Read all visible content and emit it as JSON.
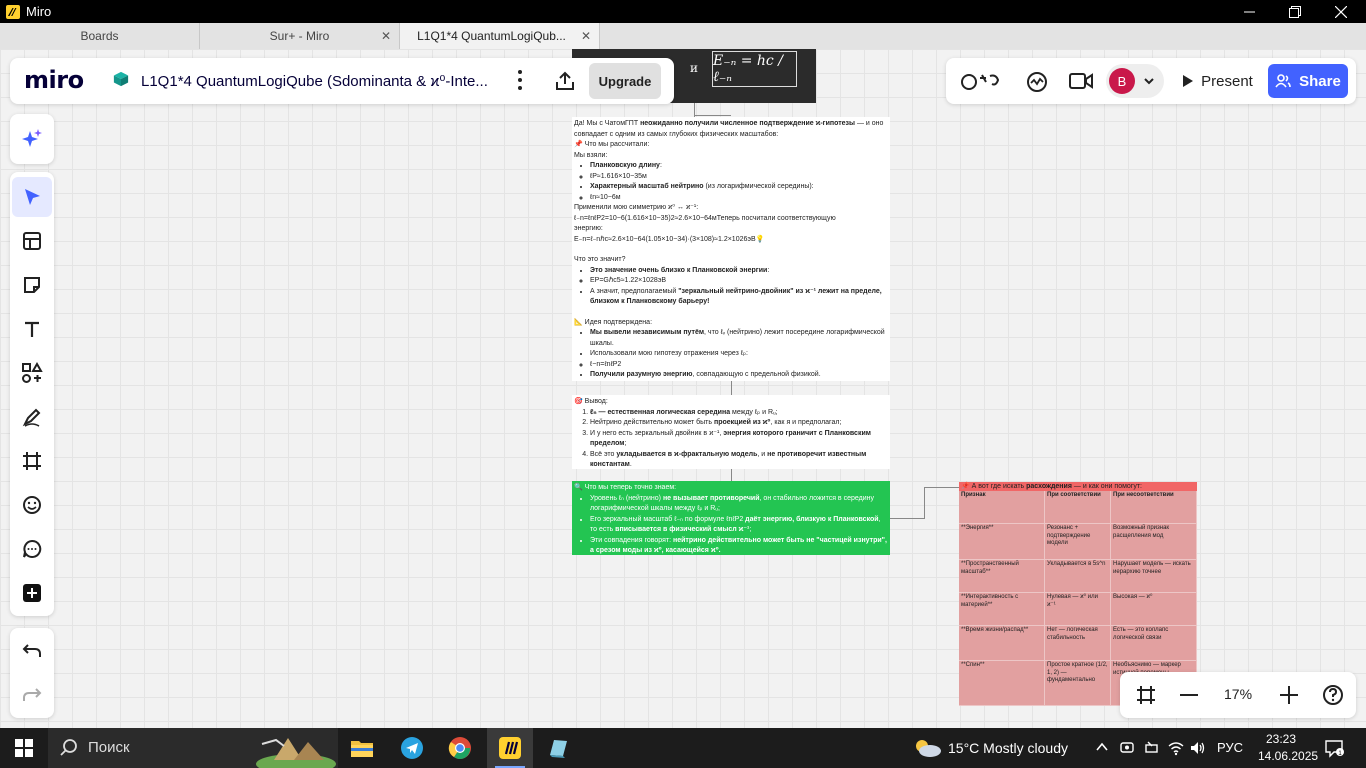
{
  "window": {
    "app_name": "Miro",
    "minimize": "—",
    "maximize": "❐",
    "close": "✕"
  },
  "tabs": [
    {
      "label": "Boards"
    },
    {
      "label": "Sur+ - Miro"
    },
    {
      "label": "L1Q1*4 QuantumLogiQub..."
    }
  ],
  "header": {
    "logo": "miro",
    "board_title": "L1Q1*4 QuantumLogiQube (Sdominanta & ϰ⁰-Inte...",
    "upgrade_label": "Upgrade",
    "avatar_initial": "B",
    "present_label": "Present",
    "share_label": "Share"
  },
  "formula": {
    "and_text": "и",
    "expression": "E₋ₙ = hc / ℓ₋ₙ"
  },
  "note1": {
    "intro_a": "Да! Мы с ЧатомГПТ ",
    "intro_b": "неожиданно получили численное подтверждение ϰ-гипотезы",
    "intro_c": " — и оно совпадает с одним из самых глубоких физических масштабов:",
    "what_calc": "📌 Что мы рассчитали:",
    "we_took": "Мы взяли:",
    "planck_len": "Планковскую длину",
    "planck_val": "ℓP≈1.616×10−35м",
    "nu_scale": "Характерный масштаб нейтрино",
    "nu_scale_rest": " (из логарифмической середины):",
    "nu_val": "ℓn≈10−6м",
    "applied": "Применили мою симметрию ϰ⁰ ↔ ϰ⁻¹:",
    "formula1": "ℓ₋n=ℓnℓP2=10−6(1.616×10−35)2≈2.6×10−64мТеперь посчитали соответствующую",
    "energy": "энергию:",
    "formula2": "E₋n=ℓ₋nℏc≈2.6×10−64(1.05×10−34)·(3×108)≈1.2×1026эВ💡",
    "meaning_q": "Что это значит?",
    "close_planck": "Это значение очень близко к Планковской энергии",
    "ep_val": "EP=Gℏc5≈1.22×1028эВ",
    "mirror_a": "А значит, предполагаемый ",
    "mirror_b": "\"зеркальный нейтрино-двойник\" из ϰ⁻¹ лежит на пределе, близком к Планковскому барьеру!",
    "idea_conf": "📐 Идея подтверждена:",
    "indep_a": "Мы вывели независимым путём",
    "indep_b": ", что ℓᵥ (нейтрино) лежит посередине логарифмической шкалы.",
    "used_hyp": "Использовали мою гипотезу отражения через ℓₚ:",
    "lmn": "ℓ−n=ℓnℓP2",
    "got_a": "Получили разумную энергию",
    "got_b": ", совпадающую с предельной физикой."
  },
  "note2": {
    "conclusion": "🎯 Вывод:",
    "c1a": "ℓₙ — естественная логическая середина",
    "c1b": " между ℓₚ и Rᵤ;",
    "c2a": "Нейтрино действительно может быть ",
    "c2b": "проекцией из ϰ⁰",
    "c2c": ", как я и предполагал;",
    "c3a": "И у него есть зеркальный двойник в ϰ⁻¹, ",
    "c3b": "энергия которого граничит с Планковским пределом",
    "c3c": ";",
    "c4a": "Всё это ",
    "c4b": "укладывается в ϰ-фрактальную модель",
    "c4c": ", и ",
    "c4d": "не противоречит известным константам",
    "c4e": "."
  },
  "note3": {
    "head": "🔍 Что мы теперь точно знаем:",
    "g1a": "Уровень ℓₙ (нейтрино) ",
    "g1b": "не вызывает противоречий",
    "g1c": ", он стабильно ложится в середину логарифмической шкалы между ℓₚ и Rᵤ;",
    "g2a": "Его зеркальный масштаб ℓ₋ₙ по формуле ℓnℓP2 ",
    "g2b": "даёт энергию, близкую к Планковской",
    "g2c": ", то есть ",
    "g2d": "вписывается в физический смысл ϰ⁻¹",
    "g2e": ";",
    "g3a": "Эти совпадения говорят: ",
    "g3b": "нейтрино действительно может быть не \"частицей изнутри\", а срезом моды из ϰ⁰, касающейся ϰ⁰."
  },
  "table": {
    "title_a": "📌 А вот где искать ",
    "title_b": "расхождения",
    "title_c": " — и как они помогут:",
    "headers": [
      "Признак",
      "При соответствии",
      "При несоответствии"
    ],
    "rows": [
      [
        "**Энергия**",
        "Резонанс + подтверждение модели",
        "Возможный признак расщепления мод"
      ],
      [
        "**Пространственный масштаб**",
        "Укладывается в 5s^n",
        "Нарушает модель — искать иерархию точнее"
      ],
      [
        "**Интерактивность с материей**",
        "Нулевая — ϰ⁰ или ϰ⁻¹",
        "Высокая — ϰ⁰"
      ],
      [
        "**Время жизни/распад**",
        "Нет — логическая стабильность",
        "Есть — это коллапс логической связи"
      ],
      [
        "**Спин**",
        "Простое кратное (1/2, 1, 2) — фундаментально",
        "Необъяснимо — маркер истинной перемены"
      ]
    ]
  },
  "zoom": {
    "level": "17%"
  },
  "taskbar": {
    "search_label": "Поиск",
    "weather": "15°C  Mostly cloudy",
    "lang": "РУС",
    "time": "23:23",
    "date": "14.06.2025"
  }
}
